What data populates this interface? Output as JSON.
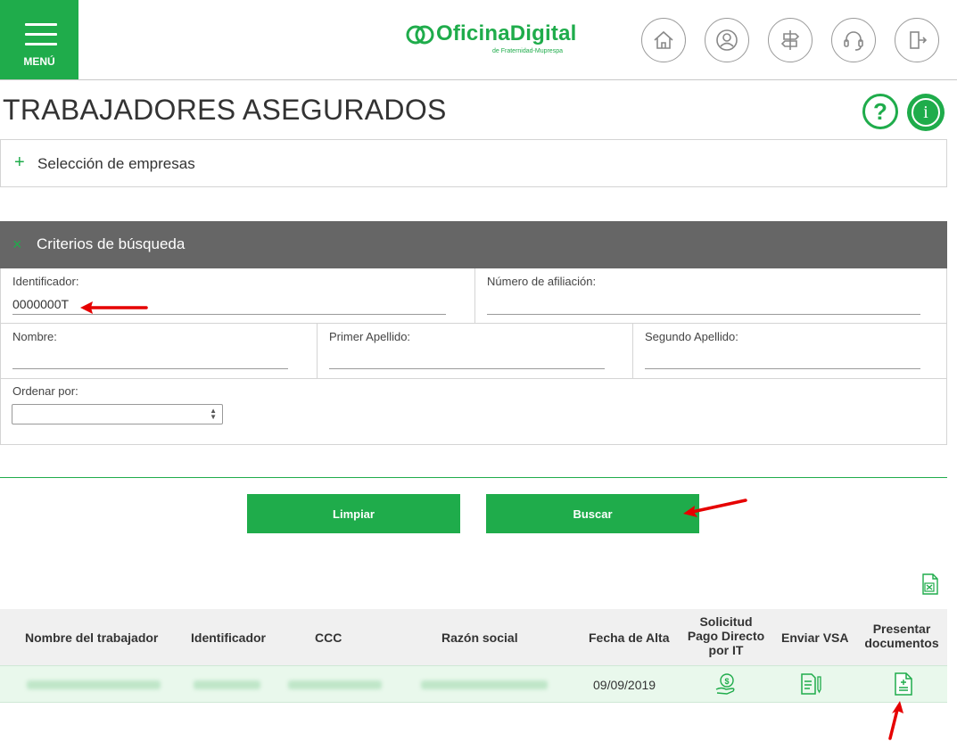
{
  "header": {
    "menu_label": "MENÚ",
    "logo_name": "OficinaDigital",
    "logo_sub": "de Fraternidad-Muprespa",
    "nav_icons": [
      "home-icon",
      "user-icon",
      "signpost-icon",
      "headset-icon",
      "logout-icon"
    ]
  },
  "page": {
    "title": "TRABAJADORES ASEGURADOS",
    "help_label": "?",
    "info_label": "i"
  },
  "empresas_panel": {
    "label": "Selección de empresas",
    "toggle_symbol": "+"
  },
  "criteria": {
    "header": "Criterios de búsqueda",
    "toggle_symbol": "×",
    "identificador_label": "Identificador:",
    "identificador_value": "0000000T",
    "afiliacion_label": "Número de afiliación:",
    "afiliacion_value": "",
    "nombre_label": "Nombre:",
    "nombre_value": "",
    "primer_apellido_label": "Primer Apellido:",
    "primer_apellido_value": "",
    "segundo_apellido_label": "Segundo Apellido:",
    "segundo_apellido_value": "",
    "ordenar_label": "Ordenar por:",
    "ordenar_value": ""
  },
  "actions": {
    "clear_label": "Limpiar",
    "search_label": "Buscar"
  },
  "table": {
    "columns": [
      "Nombre del trabajador",
      "Identificador",
      "CCC",
      "Razón social",
      "Fecha de Alta",
      "Solicitud Pago Directo por IT",
      "Enviar VSA",
      "Presentar documentos"
    ],
    "rows": [
      {
        "fecha_alta": "09/09/2019"
      }
    ]
  },
  "colors": {
    "brand_green": "#1fac4b",
    "header_gray": "#666666",
    "row_highlight": "#e9f8ec",
    "annotation_red": "#e60000"
  }
}
